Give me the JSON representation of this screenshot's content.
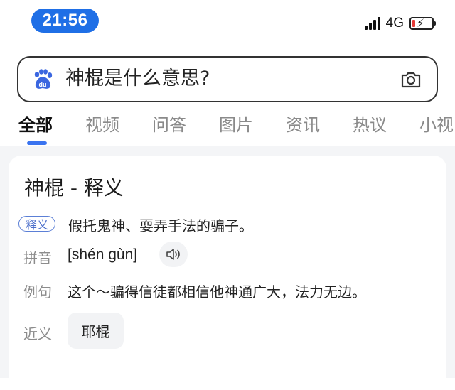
{
  "status_bar": {
    "time": "21:56",
    "network": "4G",
    "signal_icon": "cellular-signal-icon",
    "battery_icon": "battery-charging-icon",
    "battery_color": "#e53935",
    "accent": "#1f6fe6"
  },
  "search": {
    "query": "神棍是什么意思?",
    "left_icon": "baidu-paw-icon",
    "right_icon": "camera-icon"
  },
  "tabs": [
    "全部",
    "视频",
    "问答",
    "图片",
    "资讯",
    "热议",
    "小视"
  ],
  "active_tab": "全部",
  "card": {
    "title": "神棍 - 释义",
    "definition_label": "释义",
    "definition_text": "假托鬼神、耍弄手法的骗子。",
    "pinyin_label": "拼音",
    "pinyin_text": "[shén gùn]",
    "pinyin_icon": "speaker-icon",
    "example_label": "例句",
    "example_text": "这个～骗得信徒都相信他神通广大，法力无边。",
    "synonym_label": "近义",
    "synonym_chip": "耶棍"
  }
}
